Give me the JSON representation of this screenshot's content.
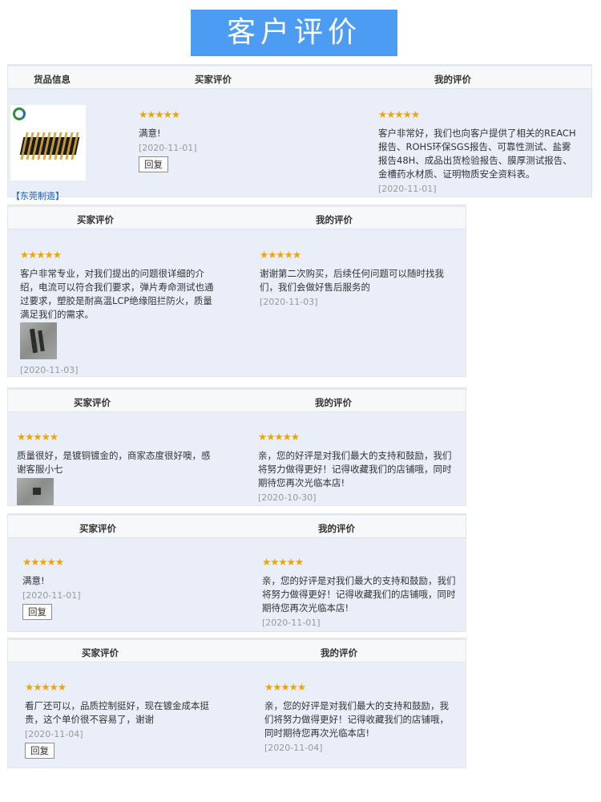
{
  "banner": {
    "title": "客户评价"
  },
  "header": {
    "goods_info": "货品信息",
    "buyer_review": "买家评价",
    "my_review": "我的评价"
  },
  "shop": {
    "link_text": "【东莞制造】"
  },
  "stars": "★★★★★",
  "reply_label": "回复",
  "reviews": [
    {
      "buyer_text": "满意!",
      "buyer_date": "[2020-11-01]",
      "seller_text": "客户非常好，我们也向客户提供了相关的REACH报告、ROHS环保SGS报告、可靠性测试、盐雾报告48H、成品出货检验报告、膜厚测试报告、金槽药水材质、证明物质安全资料表。",
      "seller_date": "[2020-11-01]"
    },
    {
      "buyer_text": "客户非常专业，对我们提出的问题很详细的介绍，电流可以符合我们要求，弹片寿命测试也通过要求，塑胶是耐高温LCP绝缘阻拦防火，质量满足我们的需求。",
      "buyer_date": "[2020-11-03]",
      "seller_text": "谢谢第二次购买，后续任何问题可以随时找我们，我们会做好售后服务的",
      "seller_date": "[2020-11-03]"
    },
    {
      "buyer_text": "质量很好，是镀铜镀金的，商家态度很好噢，感谢客服小七",
      "seller_text": "亲，您的好评是对我们最大的支持和鼓励，我们将努力做得更好！记得收藏我们的店铺哦，同时期待您再次光临本店!",
      "seller_date": "[2020-10-30]"
    },
    {
      "buyer_text": "满意!",
      "buyer_date": "[2020-11-01]",
      "seller_text": "亲，您的好评是对我们最大的支持和鼓励，我们将努力做得更好！记得收藏我们的店铺哦，同时期待您再次光临本店!",
      "seller_date": "[2020-11-01]"
    },
    {
      "buyer_text": "看厂还可以，品质控制挺好，现在镀金成本挺贵，这个单价很不容易了，谢谢",
      "buyer_date": "[2020-11-04]",
      "seller_text": "亲，您的好评是对我们最大的支持和鼓励，我们将努力做得更好！记得收藏我们的店铺哦，同时期待您再次光临本店!",
      "seller_date": "[2020-11-04]"
    }
  ]
}
